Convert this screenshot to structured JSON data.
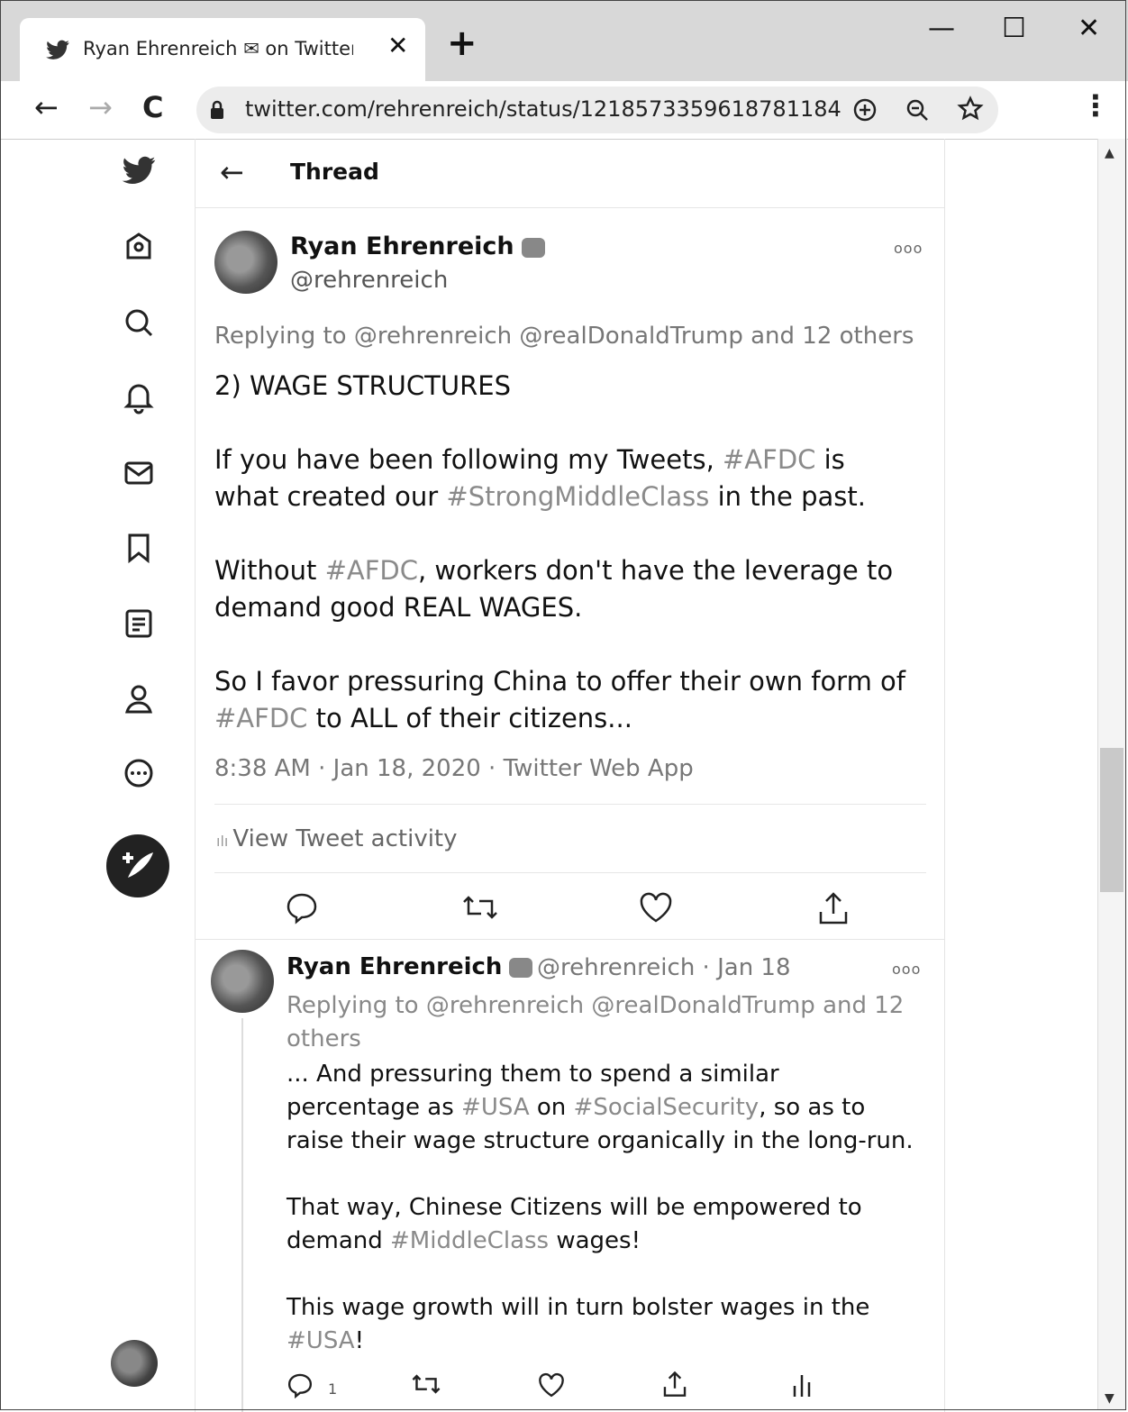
{
  "browser": {
    "tab_title": "Ryan Ehrenreich ✉ on Twitter: \"",
    "tab_close": "✕",
    "new_tab": "+",
    "url": "twitter.com/rehrenreich/status/1218573359618781184",
    "window_minimize": "—",
    "window_maximize": "☐",
    "window_close": "✕",
    "nav_back": "←",
    "nav_forward": "→",
    "nav_reload": "C",
    "menu": "⋮"
  },
  "header": {
    "back": "←",
    "title": "Thread"
  },
  "main_tweet": {
    "name": "Ryan Ehrenreich",
    "handle": "@rehrenreich",
    "more": "ooo",
    "replying_prefix": "Replying to ",
    "replying_mentions": "@rehrenreich @realDonaldTrump",
    "replying_suffix": " and 12 others",
    "line1": "2) WAGE STRUCTURES",
    "p2a": "If you have been following my Tweets, ",
    "p2_tag1": "#AFDC",
    "p2b": " is what created our ",
    "p2_tag2": "#StrongMiddleClass",
    "p2c": " in the past.",
    "p3a": "Without ",
    "p3_tag": "#AFDC",
    "p3b": ", workers don't have the leverage to demand good REAL WAGES.",
    "p4a": "So I favor pressuring China to offer their own form of ",
    "p4_tag": "#AFDC",
    "p4b": " to ALL of their citizens...",
    "timestamp": "8:38 AM · Jan 18, 2020 · Twitter Web App",
    "activity": "View Tweet activity"
  },
  "reply_tweet": {
    "name": "Ryan Ehrenreich",
    "handle_date": "@rehrenreich · Jan 18",
    "more": "ooo",
    "replying": "Replying to @rehrenreich @realDonaldTrump and 12 others",
    "p1a": "... And pressuring them to spend a similar percentage as ",
    "p1_tag1": "#USA",
    "p1b": " on ",
    "p1_tag2": "#SocialSecurity",
    "p1c": ", so as to raise their wage structure organically in the long-run.",
    "p2a": "That way, Chinese Citizens will be empowered to demand ",
    "p2_tag": "#MiddleClass",
    "p2b": " wages!",
    "p3a": "This wage growth will in turn bolster wages in the ",
    "p3_tag": "#USA",
    "p3b": "!",
    "reply_count": "1"
  }
}
